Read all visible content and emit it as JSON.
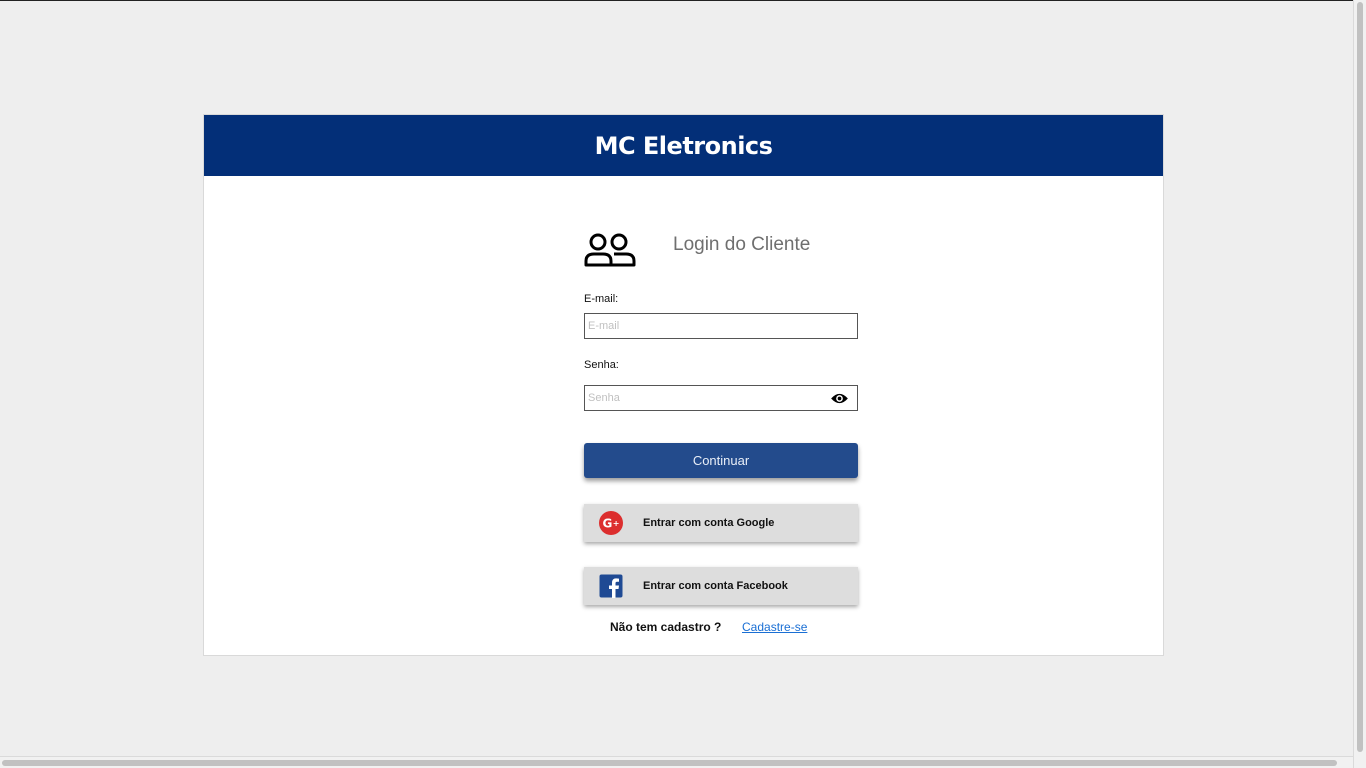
{
  "header": {
    "brand": "MC Eletronics"
  },
  "login": {
    "title": "Login do Cliente",
    "email_label": "E-mail:",
    "email_placeholder": "E-mail",
    "email_value": "",
    "password_label": "Senha:",
    "password_placeholder": "Senha",
    "password_value": "",
    "continue_label": "Continuar",
    "google_label": "Entrar com conta Google",
    "facebook_label": "Entrar com conta Facebook",
    "signup_question": "Não tem cadastro ?",
    "signup_link": "Cadastre-se"
  },
  "icons": {
    "users": "users-icon",
    "eye": "eye-icon",
    "google": "google-plus-icon",
    "facebook": "facebook-icon"
  },
  "colors": {
    "header_bg": "#032f78",
    "primary_button": "#234b8c",
    "google_red": "#dc2e2e",
    "facebook_blue": "#1f4a94",
    "link": "#1a6fd4"
  }
}
